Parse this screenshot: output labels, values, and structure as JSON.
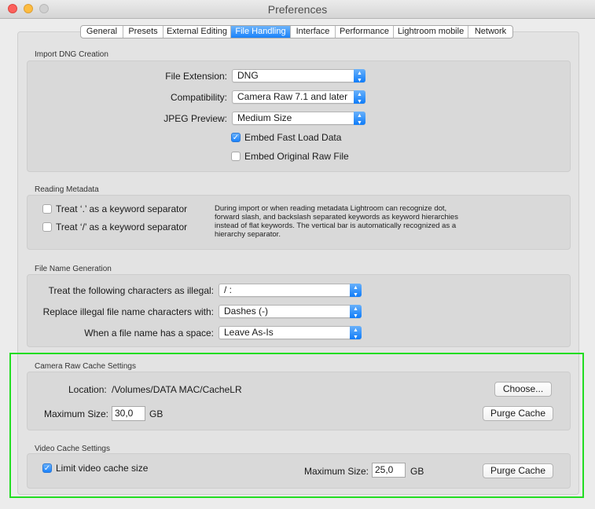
{
  "window": {
    "title": "Preferences"
  },
  "tabs": [
    {
      "label": "General"
    },
    {
      "label": "Presets"
    },
    {
      "label": "External Editing"
    },
    {
      "label": "File Handling",
      "active": true
    },
    {
      "label": "Interface"
    },
    {
      "label": "Performance"
    },
    {
      "label": "Lightroom mobile"
    },
    {
      "label": "Network"
    }
  ],
  "import_dng": {
    "title": "Import DNG Creation",
    "file_extension": {
      "label": "File Extension:",
      "value": "DNG"
    },
    "compatibility": {
      "label": "Compatibility:",
      "value": "Camera Raw 7.1 and later"
    },
    "jpeg_preview": {
      "label": "JPEG Preview:",
      "value": "Medium Size"
    },
    "embed_fast_load": {
      "label": "Embed Fast Load Data",
      "checked": true
    },
    "embed_original_raw": {
      "label": "Embed Original Raw File",
      "checked": false
    }
  },
  "reading_metadata": {
    "title": "Reading Metadata",
    "dot_separator": {
      "label": "Treat ‘.’ as a keyword separator",
      "checked": false
    },
    "slash_separator": {
      "label": "Treat ‘/’ as a keyword separator",
      "checked": false
    },
    "description": "During import or when reading metadata Lightroom can recognize dot, forward slash, and backslash separated keywords as keyword hierarchies instead of flat keywords. The vertical bar is automatically recognized as a hierarchy separator."
  },
  "file_name_generation": {
    "title": "File Name Generation",
    "illegal_chars": {
      "label": "Treat the following characters as illegal:",
      "value": "/ :"
    },
    "replace_with": {
      "label": "Replace illegal file name characters with:",
      "value": "Dashes (-)"
    },
    "space_handling": {
      "label": "When a file name has a space:",
      "value": "Leave As-Is"
    }
  },
  "camera_raw_cache": {
    "title": "Camera Raw Cache Settings",
    "location_label": "Location:",
    "location_value": "/Volumes/DATA MAC/CacheLR",
    "choose_button": "Choose...",
    "max_size_label": "Maximum Size:",
    "max_size_value": "30,0",
    "max_size_unit": "GB",
    "purge_button": "Purge Cache"
  },
  "video_cache": {
    "title": "Video Cache Settings",
    "limit_checkbox": {
      "label": "Limit video cache size",
      "checked": true
    },
    "max_size_label": "Maximum Size:",
    "max_size_value": "25,0",
    "max_size_unit": "GB",
    "purge_button": "Purge Cache"
  },
  "colors": {
    "accent": "#1a82fb",
    "highlight_box": "#22dd22"
  }
}
